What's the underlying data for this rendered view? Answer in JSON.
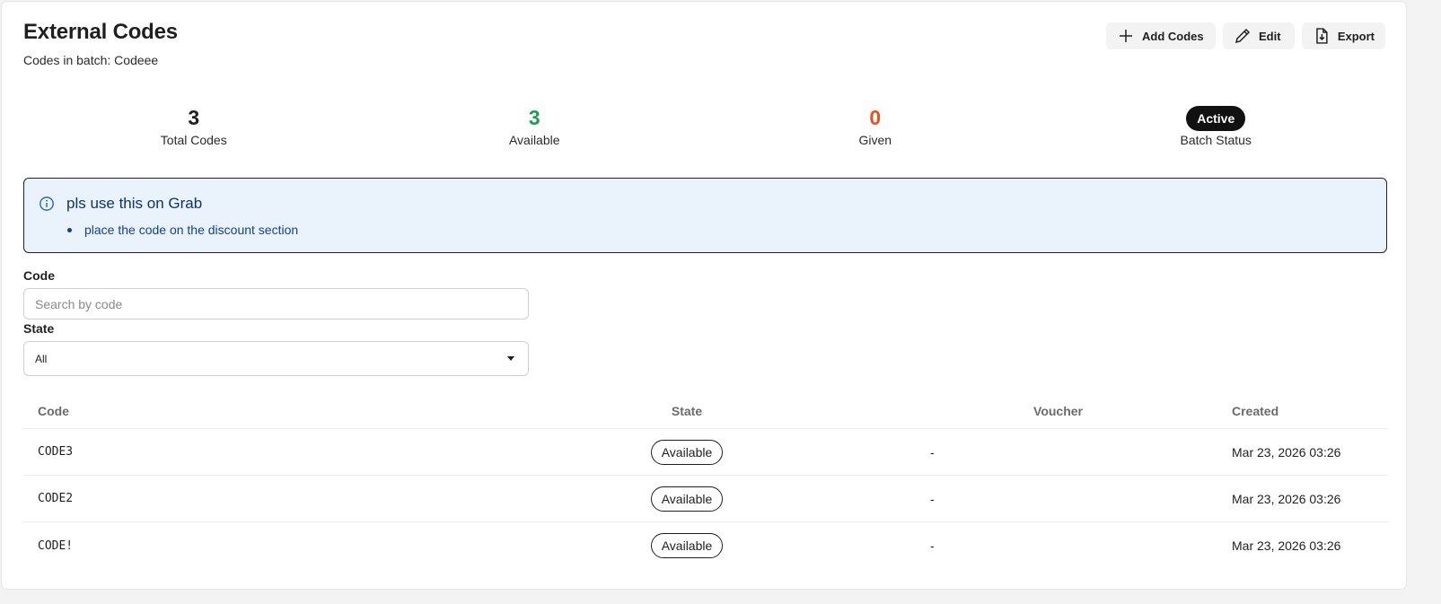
{
  "header": {
    "title": "External Codes",
    "subtitle": "Codes in batch: Codeee"
  },
  "toolbar": {
    "add_label": "Add Codes",
    "edit_label": "Edit",
    "export_label": "Export"
  },
  "stats": {
    "total_value": "3",
    "total_label": "Total Codes",
    "available_value": "3",
    "available_label": "Available",
    "given_value": "0",
    "given_label": "Given",
    "status_value": "Active",
    "status_label": "Batch Status"
  },
  "notice": {
    "title": "pls use this on Grab",
    "items": [
      "place the code on the discount section"
    ]
  },
  "filters": {
    "code_label": "Code",
    "code_placeholder": "Search by code",
    "code_value": "",
    "state_label": "State",
    "state_selected": "All"
  },
  "table": {
    "columns": [
      "Code",
      "State",
      "Voucher",
      "Created"
    ],
    "rows": [
      {
        "code": "CODE3",
        "state": "Available",
        "voucher": "-",
        "created": "Mar 23, 2026 03:26"
      },
      {
        "code": "CODE2",
        "state": "Available",
        "voucher": "-",
        "created": "Mar 23, 2026 03:26"
      },
      {
        "code": "CODE!",
        "state": "Available",
        "voucher": "-",
        "created": "Mar 23, 2026 03:26"
      }
    ]
  },
  "colors": {
    "available": "#1f9d55",
    "given": "#e8501e",
    "notice_bg": "#eaf2fc",
    "notice_text": "#113366",
    "badge_bg": "#111111"
  },
  "icons": {
    "add": "plus-icon",
    "edit": "pencil-icon",
    "export": "file-download-icon",
    "notice": "info-icon",
    "select": "caret-down-icon"
  }
}
